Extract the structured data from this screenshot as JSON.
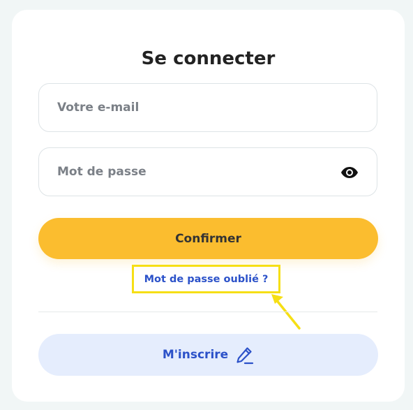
{
  "login": {
    "title": "Se connecter",
    "email_placeholder": "Votre e-mail",
    "password_placeholder": "Mot de passe",
    "confirm_label": "Confirmer",
    "forgot_label": "Mot de passe oublié ?",
    "register_label": "M'inscrire",
    "icons": {
      "password_toggle": "eye-icon",
      "register": "pencil-icon"
    }
  },
  "colors": {
    "page_background": "#f1f6f6",
    "card_background": "#ffffff",
    "accent": "#fbbd2f",
    "link": "#2c52c9",
    "register_background": "#e5edfd",
    "highlight": "#f6df15"
  }
}
